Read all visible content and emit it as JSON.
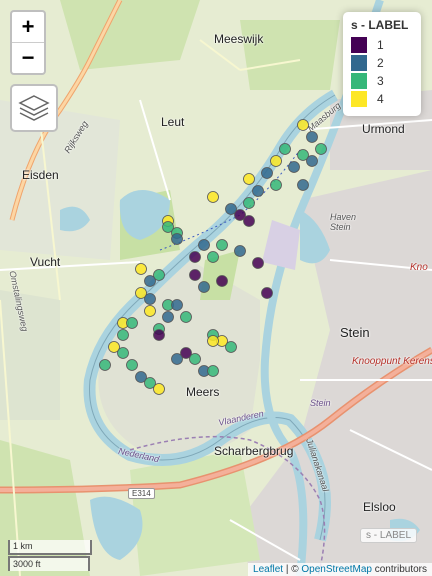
{
  "map": {
    "places": {
      "meeswijk": "Meeswijk",
      "leut": "Leut",
      "eisden": "Eisden",
      "vucht": "Vucht",
      "urmond": "Urmond",
      "haven_stein": "Haven\nStein",
      "stein": "Stein",
      "meers": "Meers",
      "scharbergbrug": "Scharbergbrug",
      "elsloo": "Elsloo",
      "knooppunt": "Knooppunt Kerensheide",
      "kno": "Kno",
      "vlaanderen": "Vlaanderen",
      "nederland": "Nederland",
      "stein_small": "Stein",
      "rijksweg": "Rijksweg",
      "omstalweg": "Omstalingsweg",
      "julianakanaal": "Julianakanaal",
      "maasburg": "Maasburg"
    },
    "road_labels": {
      "e314": "E314"
    }
  },
  "controls": {
    "zoom_in": "+",
    "zoom_out": "−"
  },
  "legend": {
    "title": "s - LABEL",
    "items": [
      {
        "label": "1",
        "color": "#440154"
      },
      {
        "label": "2",
        "color": "#31688e"
      },
      {
        "label": "3",
        "color": "#35b779"
      },
      {
        "label": "4",
        "color": "#fde725"
      }
    ]
  },
  "watermark": "s - LABEL",
  "scale": {
    "km": "1 km",
    "ft": "3000 ft"
  },
  "attribution": {
    "leaflet": "Leaflet",
    "sep": " | © ",
    "osm": "OpenStreetMap",
    "suffix": " contributors"
  },
  "points": [
    {
      "lat": 51.01,
      "lng": 5.742,
      "label": 4
    },
    {
      "lat": 51.008,
      "lng": 5.743,
      "label": 2
    },
    {
      "lat": 51.006,
      "lng": 5.74,
      "label": 3
    },
    {
      "lat": 51.004,
      "lng": 5.739,
      "label": 4
    },
    {
      "lat": 51.005,
      "lng": 5.742,
      "label": 3
    },
    {
      "lat": 51.003,
      "lng": 5.741,
      "label": 2
    },
    {
      "lat": 51.002,
      "lng": 5.738,
      "label": 2
    },
    {
      "lat": 51.001,
      "lng": 5.736,
      "label": 4
    },
    {
      "lat": 51.0,
      "lng": 5.739,
      "label": 3
    },
    {
      "lat": 50.999,
      "lng": 5.737,
      "label": 2
    },
    {
      "lat": 50.998,
      "lng": 5.732,
      "label": 4
    },
    {
      "lat": 50.997,
      "lng": 5.736,
      "label": 3
    },
    {
      "lat": 50.996,
      "lng": 5.734,
      "label": 2
    },
    {
      "lat": 50.995,
      "lng": 5.735,
      "label": 1
    },
    {
      "lat": 50.994,
      "lng": 5.736,
      "label": 1
    },
    {
      "lat": 50.994,
      "lng": 5.727,
      "label": 4
    },
    {
      "lat": 50.993,
      "lng": 5.727,
      "label": 3
    },
    {
      "lat": 50.992,
      "lng": 5.728,
      "label": 3
    },
    {
      "lat": 50.991,
      "lng": 5.728,
      "label": 2
    },
    {
      "lat": 50.99,
      "lng": 5.731,
      "label": 2
    },
    {
      "lat": 50.99,
      "lng": 5.733,
      "label": 3
    },
    {
      "lat": 50.989,
      "lng": 5.735,
      "label": 2
    },
    {
      "lat": 50.988,
      "lng": 5.73,
      "label": 1
    },
    {
      "lat": 50.988,
      "lng": 5.732,
      "label": 3
    },
    {
      "lat": 50.987,
      "lng": 5.737,
      "label": 1
    },
    {
      "lat": 50.986,
      "lng": 5.724,
      "label": 4
    },
    {
      "lat": 50.985,
      "lng": 5.726,
      "label": 3
    },
    {
      "lat": 50.985,
      "lng": 5.73,
      "label": 1
    },
    {
      "lat": 50.984,
      "lng": 5.725,
      "label": 2
    },
    {
      "lat": 50.984,
      "lng": 5.733,
      "label": 1
    },
    {
      "lat": 50.983,
      "lng": 5.731,
      "label": 2
    },
    {
      "lat": 50.982,
      "lng": 5.738,
      "label": 1
    },
    {
      "lat": 50.982,
      "lng": 5.724,
      "label": 4
    },
    {
      "lat": 50.981,
      "lng": 5.725,
      "label": 2
    },
    {
      "lat": 50.98,
      "lng": 5.727,
      "label": 3
    },
    {
      "lat": 50.98,
      "lng": 5.728,
      "label": 2
    },
    {
      "lat": 50.979,
      "lng": 5.725,
      "label": 4
    },
    {
      "lat": 50.978,
      "lng": 5.727,
      "label": 2
    },
    {
      "lat": 50.978,
      "lng": 5.729,
      "label": 3
    },
    {
      "lat": 50.977,
      "lng": 5.722,
      "label": 4
    },
    {
      "lat": 50.977,
      "lng": 5.723,
      "label": 3
    },
    {
      "lat": 50.976,
      "lng": 5.726,
      "label": 3
    },
    {
      "lat": 50.975,
      "lng": 5.722,
      "label": 3
    },
    {
      "lat": 50.975,
      "lng": 5.726,
      "label": 1
    },
    {
      "lat": 50.975,
      "lng": 5.732,
      "label": 3
    },
    {
      "lat": 50.974,
      "lng": 5.733,
      "label": 4
    },
    {
      "lat": 50.974,
      "lng": 5.732,
      "label": 4
    },
    {
      "lat": 50.973,
      "lng": 5.734,
      "label": 3
    },
    {
      "lat": 50.973,
      "lng": 5.721,
      "label": 4
    },
    {
      "lat": 50.972,
      "lng": 5.722,
      "label": 3
    },
    {
      "lat": 50.972,
      "lng": 5.729,
      "label": 1
    },
    {
      "lat": 50.971,
      "lng": 5.73,
      "label": 3
    },
    {
      "lat": 50.971,
      "lng": 5.728,
      "label": 2
    },
    {
      "lat": 50.97,
      "lng": 5.72,
      "label": 3
    },
    {
      "lat": 50.97,
      "lng": 5.723,
      "label": 3
    },
    {
      "lat": 50.969,
      "lng": 5.731,
      "label": 2
    },
    {
      "lat": 50.969,
      "lng": 5.732,
      "label": 3
    },
    {
      "lat": 50.968,
      "lng": 5.724,
      "label": 2
    },
    {
      "lat": 50.967,
      "lng": 5.725,
      "label": 3
    },
    {
      "lat": 50.966,
      "lng": 5.726,
      "label": 4
    },
    {
      "lat": 51.006,
      "lng": 5.744,
      "label": 3
    },
    {
      "lat": 51.004,
      "lng": 5.743,
      "label": 2
    },
    {
      "lat": 51.0,
      "lng": 5.742,
      "label": 2
    }
  ]
}
